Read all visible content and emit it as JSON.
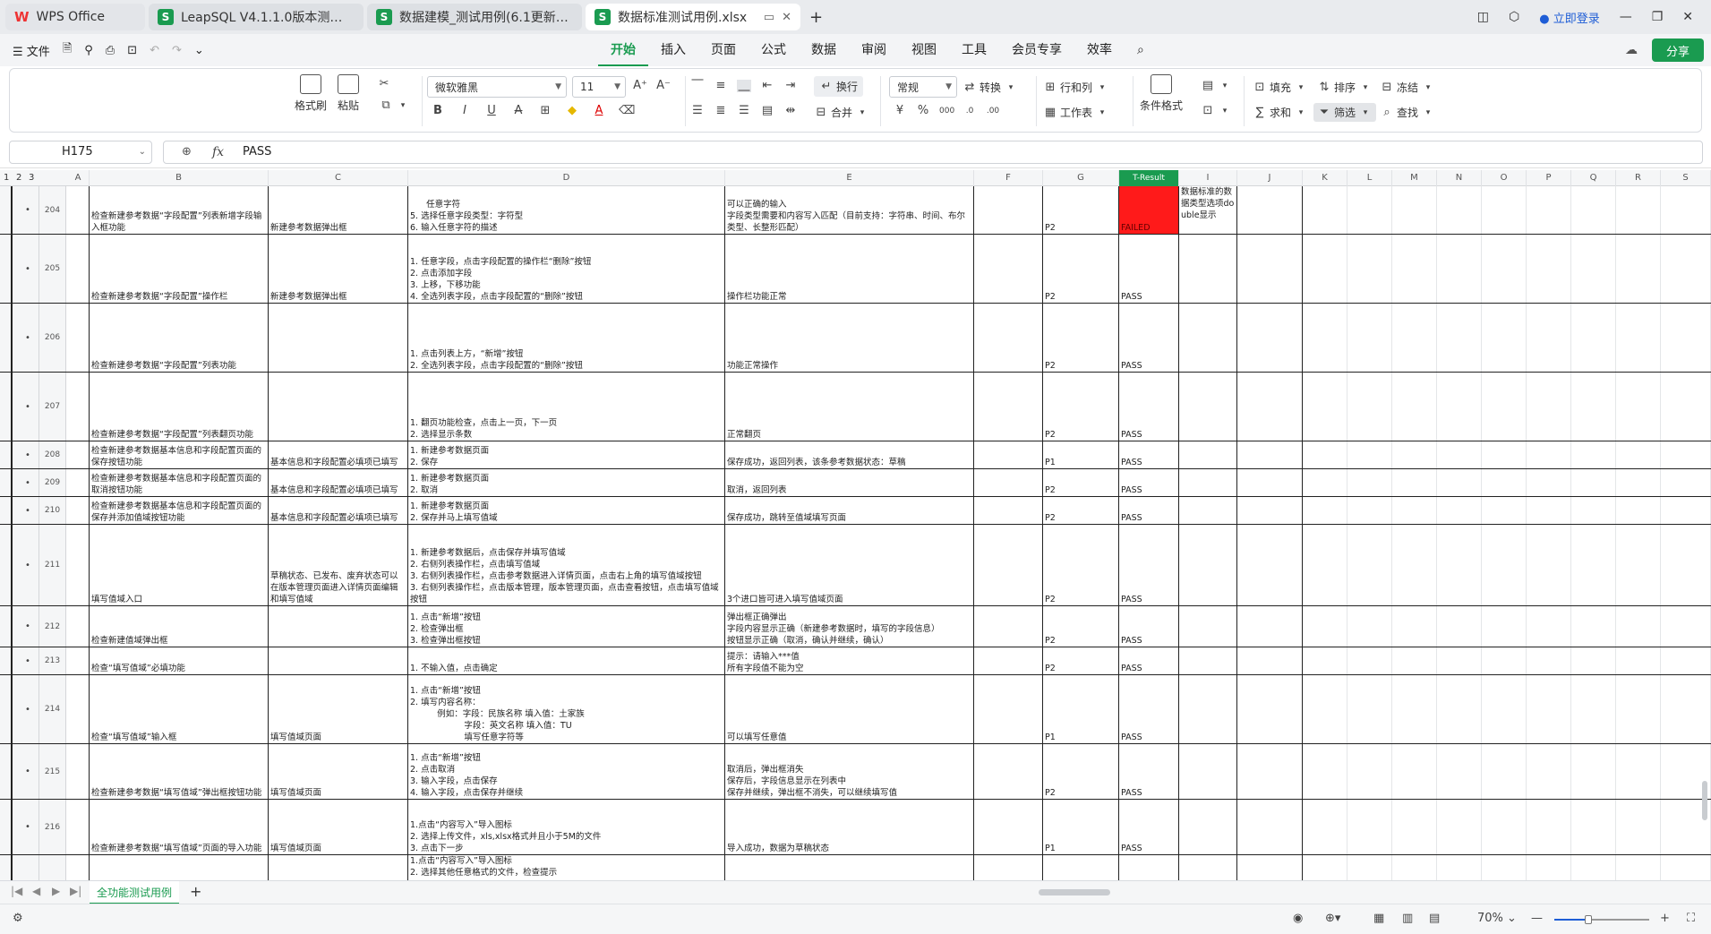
{
  "tabs": [
    {
      "label": "WPS Office",
      "kind": "wps"
    },
    {
      "label": "LeapSQL V4.1.1.0版本测试用例.xlsx",
      "kind": "doc"
    },
    {
      "label": "数据建模_测试用例(6.1更新).xlsx",
      "kind": "doc"
    },
    {
      "label": "数据标准测试用例.xlsx",
      "kind": "active"
    }
  ],
  "titlebar": {
    "login": "立即登录",
    "new_tab": "+"
  },
  "menu": {
    "file": "文件",
    "tabs": [
      "开始",
      "插入",
      "页面",
      "公式",
      "数据",
      "审阅",
      "视图",
      "工具",
      "会员专享",
      "效率"
    ],
    "active_tab": "开始",
    "share": "分享"
  },
  "ribbon": {
    "format_painter": "格式刷",
    "paste": "粘贴",
    "font_name": "微软雅黑",
    "font_size": "11",
    "wrap": "换行",
    "merge": "合并",
    "number_format": "常规",
    "convert": "转换",
    "row_col": "行和列",
    "worksheet": "工作表",
    "cond_format": "条件格式",
    "fill": "填充",
    "sort": "排序",
    "freeze": "冻结",
    "sum": "求和",
    "filter": "筛选",
    "find": "查找"
  },
  "formula_bar": {
    "cell_ref": "H175",
    "fx": "fx",
    "value": "PASS"
  },
  "outline_levels": [
    "1",
    "2",
    "3"
  ],
  "columns": [
    "A",
    "B",
    "C",
    "D",
    "E",
    "F",
    "G",
    "T-Result",
    "I",
    "J",
    "K",
    "L",
    "M",
    "N",
    "O",
    "P",
    "Q",
    "R",
    "S"
  ],
  "rows": [
    {
      "num": "204",
      "b": "检查新建参考数据“字段配置”列表新增字段输入框功能",
      "c": "新建参考数据弹出框",
      "d": "      任意字符\n5. 选择任意字段类型：字符型\n6. 输入任意字符的描述",
      "e": "可以正确的输入\n字段类型需要和内容写入匹配（目前支持：字符串、时间、布尔类型、长整形匹配）",
      "g": "P2",
      "h": "FAILED",
      "i": "数据标准的数据类型选项double显示"
    },
    {
      "num": "205",
      "b": "检查新建参考数据“字段配置”操作栏",
      "c": "新建参考数据弹出框",
      "d": "1. 任意字段，点击字段配置的操作栏“删除”按钮\n2. 点击添加字段\n3. 上移，下移功能\n4. 全选列表字段，点击字段配置的“删除”按钮",
      "e": "操作栏功能正常",
      "g": "P2",
      "h": "PASS",
      "i": ""
    },
    {
      "num": "206",
      "b": "检查新建参考数据“字段配置”列表功能",
      "c": "",
      "d": "1. 点击列表上方，“新增”按钮\n2. 全选列表字段，点击字段配置的“删除”按钮",
      "e": "功能正常操作",
      "g": "P2",
      "h": "PASS",
      "i": ""
    },
    {
      "num": "207",
      "b": "检查新建参考数据“字段配置”列表翻页功能",
      "c": "",
      "d": "1. 翻页功能检查，点击上一页，下一页\n2. 选择显示条数",
      "e": "正常翻页",
      "g": "P2",
      "h": "PASS",
      "i": ""
    },
    {
      "num": "208",
      "b": "检查新建参考数据基本信息和字段配置页面的保存按钮功能",
      "c": "基本信息和字段配置必填项已填写",
      "d": "1. 新建参考数据页面\n2. 保存",
      "e": "保存成功，返回列表，该条参考数据状态：草稿",
      "g": "P1",
      "h": "PASS",
      "i": ""
    },
    {
      "num": "209",
      "b": "检查新建参考数据基本信息和字段配置页面的取消按钮功能",
      "c": "基本信息和字段配置必填项已填写",
      "d": "1. 新建参考数据页面\n2. 取消",
      "e": "取消，返回列表",
      "g": "P2",
      "h": "PASS",
      "i": ""
    },
    {
      "num": "210",
      "b": "检查新建参考数据基本信息和字段配置页面的保存并添加值域按钮功能",
      "c": "基本信息和字段配置必填项已填写",
      "d": "1. 新建参考数据页面\n2. 保存并马上填写值域",
      "e": "保存成功，跳转至值域填写页面",
      "g": "P2",
      "h": "PASS",
      "i": ""
    },
    {
      "num": "211",
      "b": "填写值域入口",
      "c": "草稿状态、已发布、废弃状态可以在版本管理页面进入详情页面编辑和填写值域",
      "d": "1. 新建参考数据后，点击保存并填写值域\n2. 右侧列表操作栏，点击填写值域\n3. 右侧列表操作栏，点击参考数据进入详情页面，点击右上角的填写值域按钮\n3. 右侧列表操作栏，点击版本管理，版本管理页面，点击查看按钮，点击填写值域按钮",
      "e": "3个进口皆可进入填写值域页面",
      "g": "P2",
      "h": "PASS",
      "i": ""
    },
    {
      "num": "212",
      "b": "检查新建值域弹出框",
      "c": "",
      "d": "1. 点击“新增”按钮\n2. 检查弹出框\n3. 检查弹出框按钮",
      "e": "弹出框正确弹出\n字段内容显示正确（新建参考数据时，填写的字段信息）\n按钮显示正确（取消，确认并继续，确认）",
      "g": "P2",
      "h": "PASS",
      "i": ""
    },
    {
      "num": "213",
      "b": "检查“填写值域”必填功能",
      "c": "",
      "d": "1. 不输入值，点击确定",
      "e": "提示：请输入***值\n所有字段值不能为空",
      "g": "P2",
      "h": "PASS",
      "i": ""
    },
    {
      "num": "214",
      "b": "检查“填写值域”输入框",
      "c": "填写值域页面",
      "d": "1. 点击“新增”按钮\n2. 填写内容名称：\n          例如：字段：民族名称 填入值：土家族\n                    字段：英文名称 填入值：TU\n                    填写任意字符等",
      "e": "可以填写任意值",
      "g": "P1",
      "h": "PASS",
      "i": ""
    },
    {
      "num": "215",
      "b": "检查新建参考数据“填写值域”弹出框按钮功能",
      "c": "填写值域页面",
      "d": "1. 点击“新增”按钮\n2. 点击取消\n3. 输入字段，点击保存\n4. 输入字段，点击保存并继续",
      "e": "取消后，弹出框消失\n保存后，字段信息显示在列表中\n保存并继续，弹出框不消失，可以继续填写值",
      "g": "P2",
      "h": "PASS",
      "i": ""
    },
    {
      "num": "216",
      "b": "检查新建参考数据“填写值域”页面的导入功能",
      "c": "填写值域页面",
      "d": "1.点击“内容写入”导入图标\n2. 选择上传文件，xls,xlsx格式并且小于5M的文件\n3. 点击下一步",
      "e": "导入成功，数据为草稿状态",
      "g": "P1",
      "h": "PASS",
      "i": ""
    },
    {
      "num": "",
      "b": "",
      "c": "",
      "d": "1.点击“内容写入”导入图标\n2. 选择其他任意格式的文件，检查提示",
      "e": "",
      "g": "",
      "h": "",
      "i": ""
    }
  ],
  "sheet_tab": "全功能测试用例",
  "status": {
    "zoom": "70%"
  }
}
